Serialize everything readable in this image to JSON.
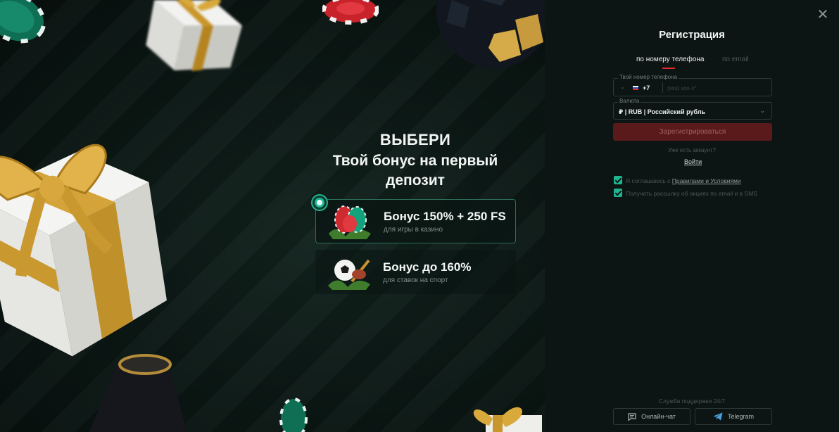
{
  "promo": {
    "headline_1": "ВЫБЕРИ",
    "headline_2": "Твой бонус на первый депозит",
    "bonuses": [
      {
        "title": "Бонус 150% + 250 FS",
        "subtitle": "для игры в казино",
        "selected": true,
        "icon": "casino-chips-icon"
      },
      {
        "title": "Бонус до 160%",
        "subtitle": "для ставок на спорт",
        "selected": false,
        "icon": "sport-ball-icon"
      }
    ]
  },
  "registration": {
    "title": "Регистрация",
    "tabs": [
      {
        "label": "по номеру телефона",
        "active": true
      },
      {
        "label": "по email",
        "active": false
      }
    ],
    "phone": {
      "legend": "Твой номер телефона",
      "country_code": "+7",
      "placeholder": "(ххх) ххх-х*"
    },
    "currency": {
      "legend": "Валюта",
      "value": "₽ | RUB | Российский рубль"
    },
    "submit_label": "Зарегистрироваться",
    "have_account": "Уже есть аккаунт?",
    "login_label": "Войти",
    "agree_prefix": "Я соглашаюсь с ",
    "agree_link": "Правилами и Условиями",
    "newsletter": "Получать рассылку об акциях по email и в SMS",
    "support_title": "Служба поддержки 24/7",
    "support_chat": "Онлайн-чат",
    "support_telegram": "Telegram"
  },
  "colors": {
    "accent_green": "#1fb590",
    "accent_red": "#e02b2b",
    "submit_disabled": "#5a1a1c",
    "panel_bg": "#0c1513"
  }
}
